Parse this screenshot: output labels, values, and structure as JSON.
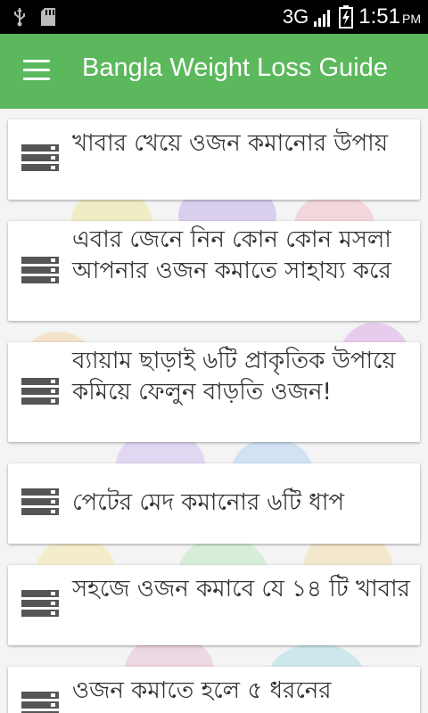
{
  "status_bar": {
    "network": "3G",
    "time": "1:51",
    "ampm": "PM",
    "icons": [
      "usb-icon",
      "sd-card-icon",
      "signal-icon",
      "battery-icon"
    ]
  },
  "app_bar": {
    "title": "Bangla Weight Loss Guide",
    "color": "#5cb85c",
    "menu_icon": "menu-icon"
  },
  "articles": [
    {
      "title": "খাবার খেয়ে ওজন কমানোর উপায়"
    },
    {
      "title": "এবার জেনে নিন কোন কোন মসলা আপনার ওজন কমাতে সাহায্য করে"
    },
    {
      "title": "ব্যায়াম ছাড়াই ৬টি প্রাকৃতিক উপায়ে কমিয়ে ফেলুন বাড়তি ওজন!"
    },
    {
      "title": "পেটের মেদ কমানোর ৬টি ধাপ"
    },
    {
      "title": "সহজে ওজন কমাবে যে ১৪ টি খাবার"
    },
    {
      "title": "ওজন কমাতে হলে ৫ ধরনের"
    }
  ]
}
